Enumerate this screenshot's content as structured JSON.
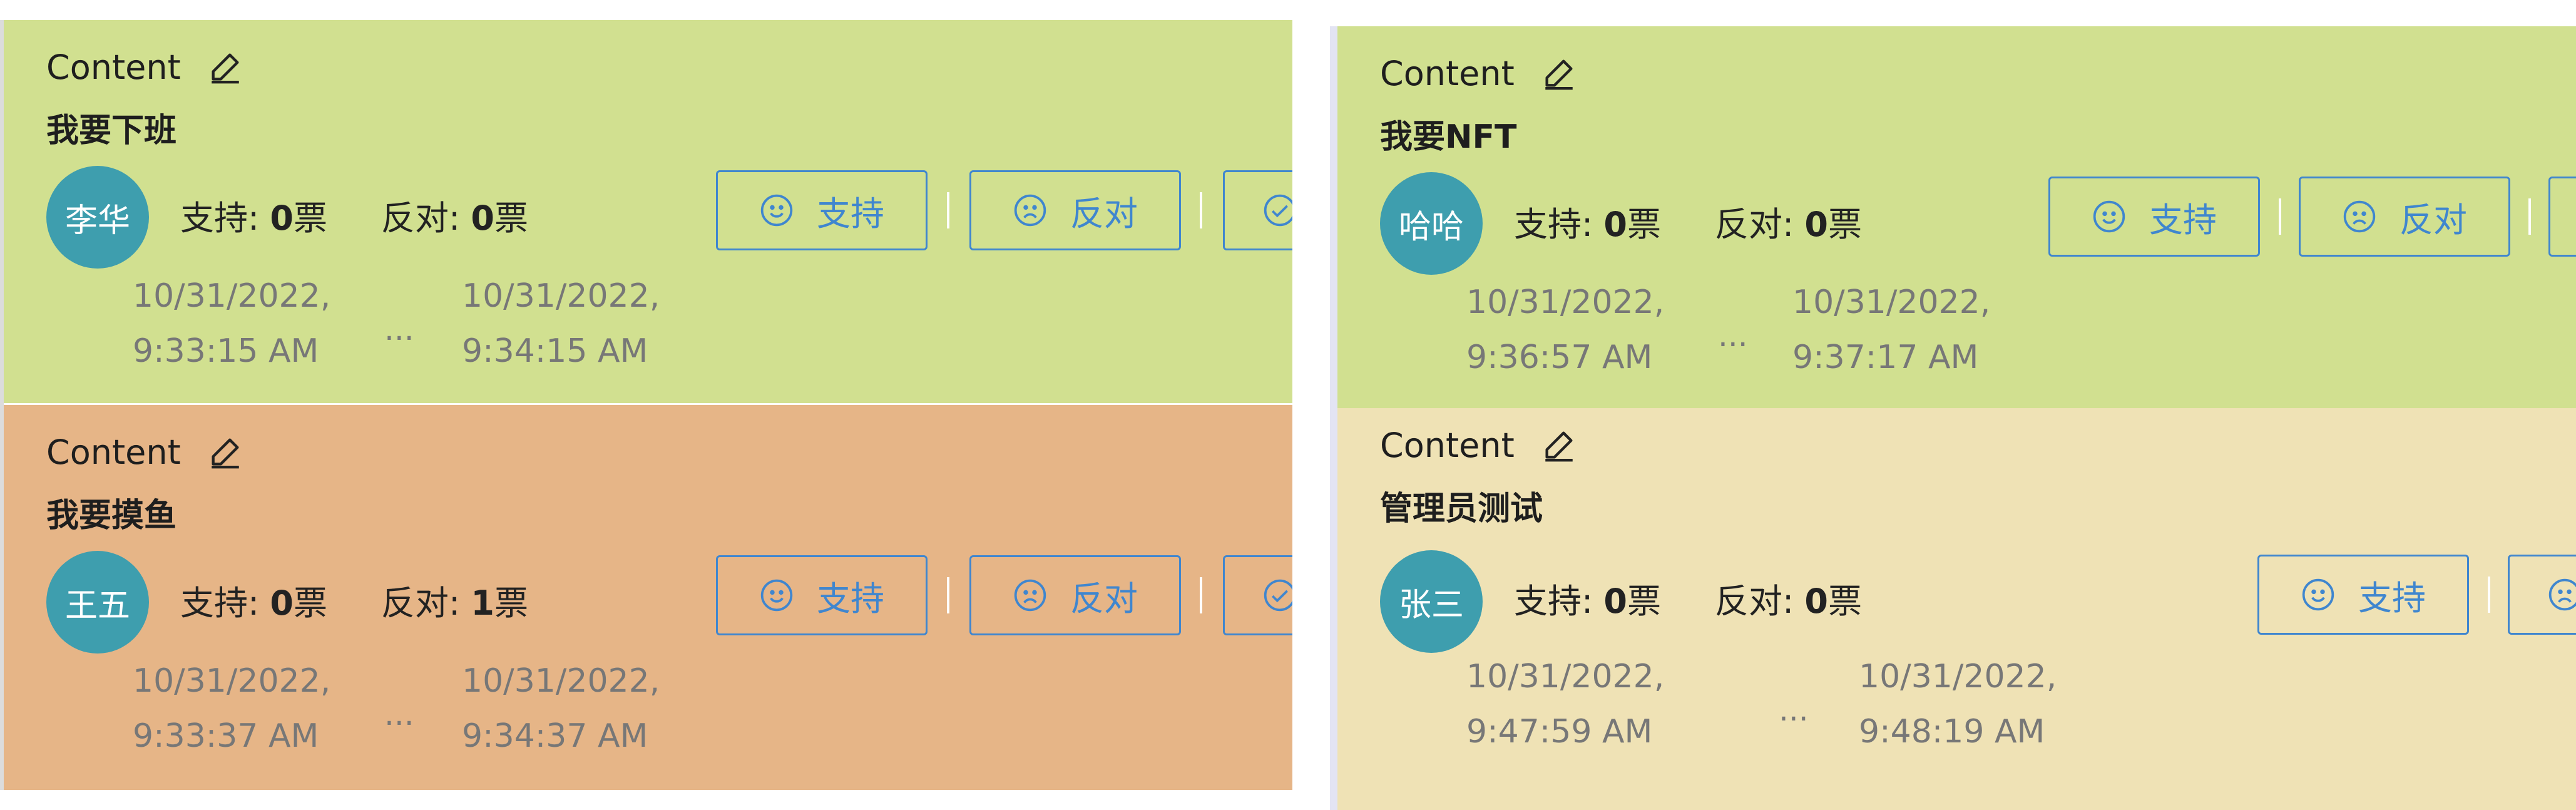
{
  "common": {
    "content_label": "Content",
    "support_label": "支持",
    "oppose_label": "反对",
    "support_prefix": "支持: ",
    "oppose_prefix": "反对: ",
    "vote_unit": "票",
    "ellipsis": "..."
  },
  "cards": [
    {
      "title": "我要下班",
      "avatar": "李华",
      "support_count": "0",
      "oppose_count": "0",
      "start_date": "10/31/2022,",
      "start_time": "9:33:15 AM",
      "end_date": "10/31/2022,",
      "end_time": "9:34:15 AM"
    },
    {
      "title": "我要摸鱼",
      "avatar": "王五",
      "support_count": "0",
      "oppose_count": "1",
      "start_date": "10/31/2022,",
      "start_time": "9:33:37 AM",
      "end_date": "10/31/2022,",
      "end_time": "9:34:37 AM"
    },
    {
      "title": "我要NFT",
      "avatar": "哈哈",
      "support_count": "0",
      "oppose_count": "0",
      "start_date": "10/31/2022,",
      "start_time": "9:36:57 AM",
      "end_date": "10/31/2022,",
      "end_time": "9:37:17 AM"
    },
    {
      "title": "管理员测试",
      "avatar": "张三",
      "support_count": "0",
      "oppose_count": "0",
      "start_date": "10/31/2022,",
      "start_time": "9:47:59 AM",
      "end_date": "10/31/2022,",
      "end_time": "9:48:19 AM"
    }
  ],
  "icons": {
    "edit": "pencil-icon",
    "support": "smile-icon",
    "oppose": "frown-icon",
    "third_action": "check-circle-icon"
  },
  "colors": {
    "approved_card": "#d1e090",
    "rejected_card": "#e6b587",
    "pending_card": "#efe2b5",
    "avatar": "#3e9eae",
    "button": "#3f86cf"
  }
}
